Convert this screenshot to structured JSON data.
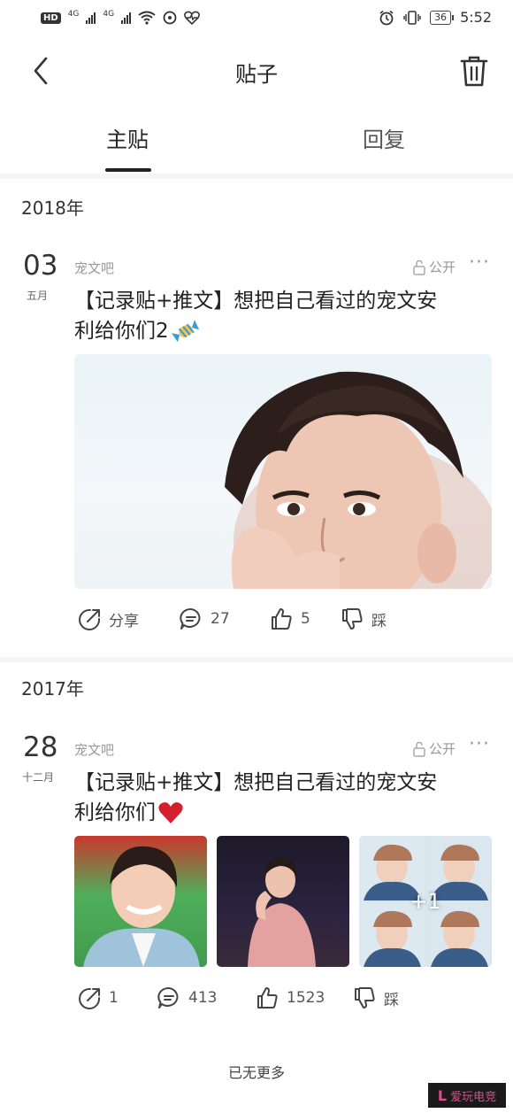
{
  "status_bar": {
    "badge": "HD",
    "net1": "4G",
    "net2": "4G",
    "battery": "36",
    "time": "5:52"
  },
  "header": {
    "title": "贴子"
  },
  "tabs": [
    {
      "label": "主贴",
      "active": true
    },
    {
      "label": "回复",
      "active": false
    }
  ],
  "posts": [
    {
      "year": "2018年",
      "day": "03",
      "month": "五月",
      "forum": "宠文吧",
      "visibility": "公开",
      "title_line1": "【记录贴+推文】想把自己看过的宠文安",
      "title_line2": "利给你们2",
      "emoji": "candy-icon",
      "actions": {
        "share": "分享",
        "comments": "27",
        "likes": "5",
        "dislike": "踩"
      }
    },
    {
      "year": "2017年",
      "day": "28",
      "month": "十二月",
      "forum": "宠文吧",
      "visibility": "公开",
      "title_line1": "【记录贴+推文】想把自己看过的宠文安",
      "title_line2": "利给你们",
      "emoji": "red-heart-icon",
      "extra_images": "+1",
      "actions": {
        "share": "1",
        "comments": "413",
        "likes": "1523",
        "dislike": "踩"
      }
    }
  ],
  "footer": {
    "end_text": "已无更多"
  },
  "watermark": {
    "text": "爱玩电竞"
  },
  "colors": {
    "text_primary": "#222222",
    "text_meta": "#999999",
    "band": "#f5f5f7",
    "heart": "#d61f2c"
  }
}
